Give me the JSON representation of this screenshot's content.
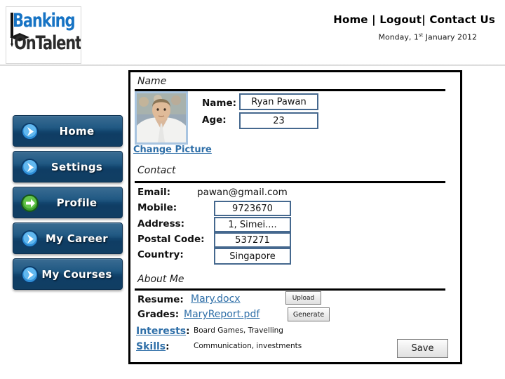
{
  "header": {
    "logo": {
      "line1": "Banking",
      "line2": "OnTalent",
      "alt": "Banking On Talent"
    },
    "nav": {
      "home": "Home",
      "sep1": "|",
      "logout": "Logout",
      "sep2": "|",
      "contact": "Contact Us"
    },
    "date": {
      "prefix": "Monday, 1",
      "ordinal": "st",
      "suffix": " January 2012"
    }
  },
  "sidebar": {
    "items": [
      {
        "label": "Home",
        "icon": "blue-circle-arrow-icon",
        "active": false
      },
      {
        "label": "Settings",
        "icon": "blue-circle-arrow-icon",
        "active": false
      },
      {
        "label": "Profile",
        "icon": "green-circle-arrow-icon",
        "active": true
      },
      {
        "label": "My Career",
        "icon": "blue-circle-arrow-icon",
        "active": false
      },
      {
        "label": "My Courses",
        "icon": "blue-circle-arrow-icon",
        "active": false
      }
    ]
  },
  "panel": {
    "name_section": {
      "title": "Name",
      "change_picture": "Change Picture",
      "fields": [
        {
          "label": "Name:",
          "value": "Ryan Pawan"
        },
        {
          "label": "Age:",
          "value": "23"
        }
      ]
    },
    "contact_section": {
      "title": "Contact",
      "email_label": "Email:",
      "email_value": "pawan@gmail.com",
      "fields": [
        {
          "label": "Mobile:",
          "value": "9723670"
        },
        {
          "label": "Address:",
          "value": "1, Simei...."
        },
        {
          "label": "Postal Code:",
          "value": "537271"
        },
        {
          "label": "Country:",
          "value": "Singapore"
        }
      ]
    },
    "about_section": {
      "title": "About Me",
      "resume_label": "Resume:",
      "resume_file": "Mary.docx",
      "upload_button": "Upload",
      "grades_label": "Grades:",
      "grades_file": "MaryReport.pdf",
      "generate_button": "Generate",
      "interests_label": "Interests",
      "interests_colon": ":",
      "interests_value": "Board Games, Travelling",
      "skills_label": "Skills",
      "skills_colon": ":",
      "skills_value": "Communication, investments",
      "save_button": "Save"
    }
  },
  "colors": {
    "nav_button": "#15507b",
    "nav_button_active_icon": "#3a9c2e",
    "input_border": "#45688e",
    "link": "#2f6fa8",
    "logo_blue": "#1673c4"
  }
}
